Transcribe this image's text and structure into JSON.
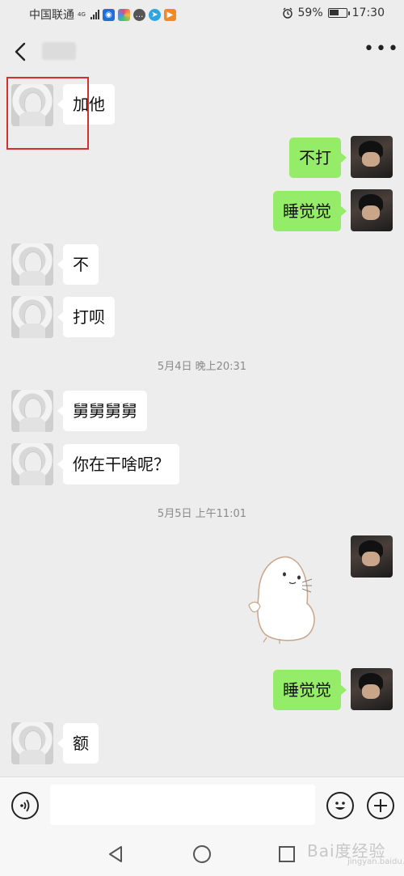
{
  "status_bar": {
    "carrier": "中国联通",
    "network_tag": "4G",
    "battery_percent": "59%",
    "battery_level": 0.59,
    "time": "17:30",
    "icons": [
      "signal-icon",
      "shield-app-icon",
      "colorful-app-icon",
      "chat-app-icon",
      "telegram-app-icon",
      "video-app-icon",
      "alarm-icon",
      "battery-icon"
    ]
  },
  "header": {
    "back_icon": "chevron-left-icon",
    "more_icon": "more-dots-icon",
    "more_label": "•••"
  },
  "messages": [
    {
      "sender": "other",
      "text": "加他"
    },
    {
      "sender": "me",
      "text": "不打"
    },
    {
      "sender": "me",
      "text": "睡觉觉"
    },
    {
      "sender": "other",
      "text": "不"
    },
    {
      "sender": "other",
      "text": "打呗"
    },
    {
      "type": "timestamp",
      "text": "5月4日 晚上20:31"
    },
    {
      "sender": "other",
      "text": "舅舅舅舅"
    },
    {
      "sender": "other",
      "text": "你在干啥呢？"
    },
    {
      "type": "timestamp",
      "text": "5月5日 上午11:01"
    },
    {
      "sender": "me",
      "type": "sticker",
      "sticker_name": "white-seal-sticker"
    },
    {
      "sender": "me",
      "text": "睡觉觉"
    },
    {
      "sender": "other",
      "text": "额"
    }
  ],
  "input_bar": {
    "voice_icon": "voice-icon",
    "emoji_icon": "emoji-icon",
    "plus_icon": "plus-icon",
    "placeholder": ""
  },
  "nav_bar": {
    "icons": [
      "nav-back-icon",
      "nav-home-icon",
      "nav-recent-icon"
    ]
  },
  "watermark": {
    "text": "Bai度经验",
    "sub": "jingyan.baidu.com"
  },
  "colors": {
    "background": "#ededed",
    "bubble_me": "#95ec69",
    "bubble_other": "#ffffff",
    "highlight": "#d32f2f"
  }
}
